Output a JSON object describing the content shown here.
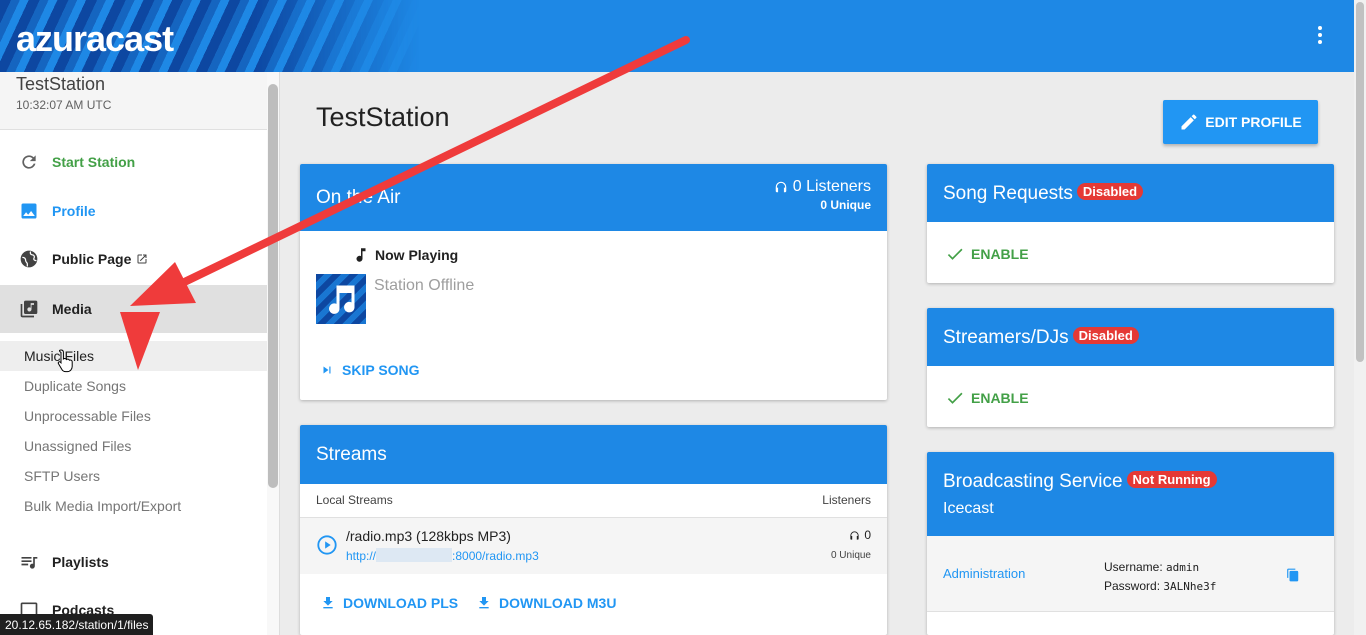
{
  "app": {
    "logo": "azuracast"
  },
  "sidebar": {
    "station_name": "TestStation",
    "station_time": "10:32:07 AM UTC",
    "items": [
      {
        "label": "Start Station",
        "icon": "refresh-icon",
        "color": "#43a047"
      },
      {
        "label": "Profile",
        "icon": "image-icon",
        "color": "#2196f3"
      },
      {
        "label": "Public Page",
        "icon": "globe-icon"
      },
      {
        "label": "Media",
        "icon": "library-music-icon"
      }
    ],
    "media_sub": [
      "Music Files",
      "Duplicate Songs",
      "Unprocessable Files",
      "Unassigned Files",
      "SFTP Users",
      "Bulk Media Import/Export"
    ],
    "more_items": [
      {
        "label": "Playlists",
        "icon": "playlist-icon"
      },
      {
        "label": "Podcasts",
        "icon": "podcast-icon"
      }
    ]
  },
  "main": {
    "title": "TestStation",
    "edit_profile": "EDIT PROFILE",
    "on_air": {
      "title": "On the Air",
      "listeners": "0 Listeners",
      "unique": "0 Unique",
      "now_playing": "Now Playing",
      "status": "Station Offline",
      "skip": "SKIP SONG"
    },
    "streams": {
      "title": "Streams",
      "col_local": "Local Streams",
      "col_listeners": "Listeners",
      "stream_name": "/radio.mp3 (128kbps MP3)",
      "url_prefix": "http://",
      "url_suffix": ":8000/radio.mp3",
      "listeners": "0",
      "unique": "0 Unique",
      "download_pls": "DOWNLOAD PLS",
      "download_m3u": "DOWNLOAD M3U"
    },
    "song_requests": {
      "title": "Song Requests",
      "badge": "Disabled",
      "action": "ENABLE"
    },
    "streamers": {
      "title": "Streamers/DJs",
      "badge": "Disabled",
      "action": "ENABLE"
    },
    "broadcasting": {
      "title": "Broadcasting Service",
      "badge": "Not Running",
      "service": "Icecast",
      "admin_link": "Administration",
      "username_label": "Username:",
      "username": "admin",
      "password_label": "Password:",
      "password": "3ALNhe3f"
    }
  },
  "status_url": "20.12.65.182/station/1/files",
  "colors": {
    "primary": "#1e88e5",
    "accent": "#2196f3",
    "success": "#43a047",
    "danger": "#e53935"
  }
}
